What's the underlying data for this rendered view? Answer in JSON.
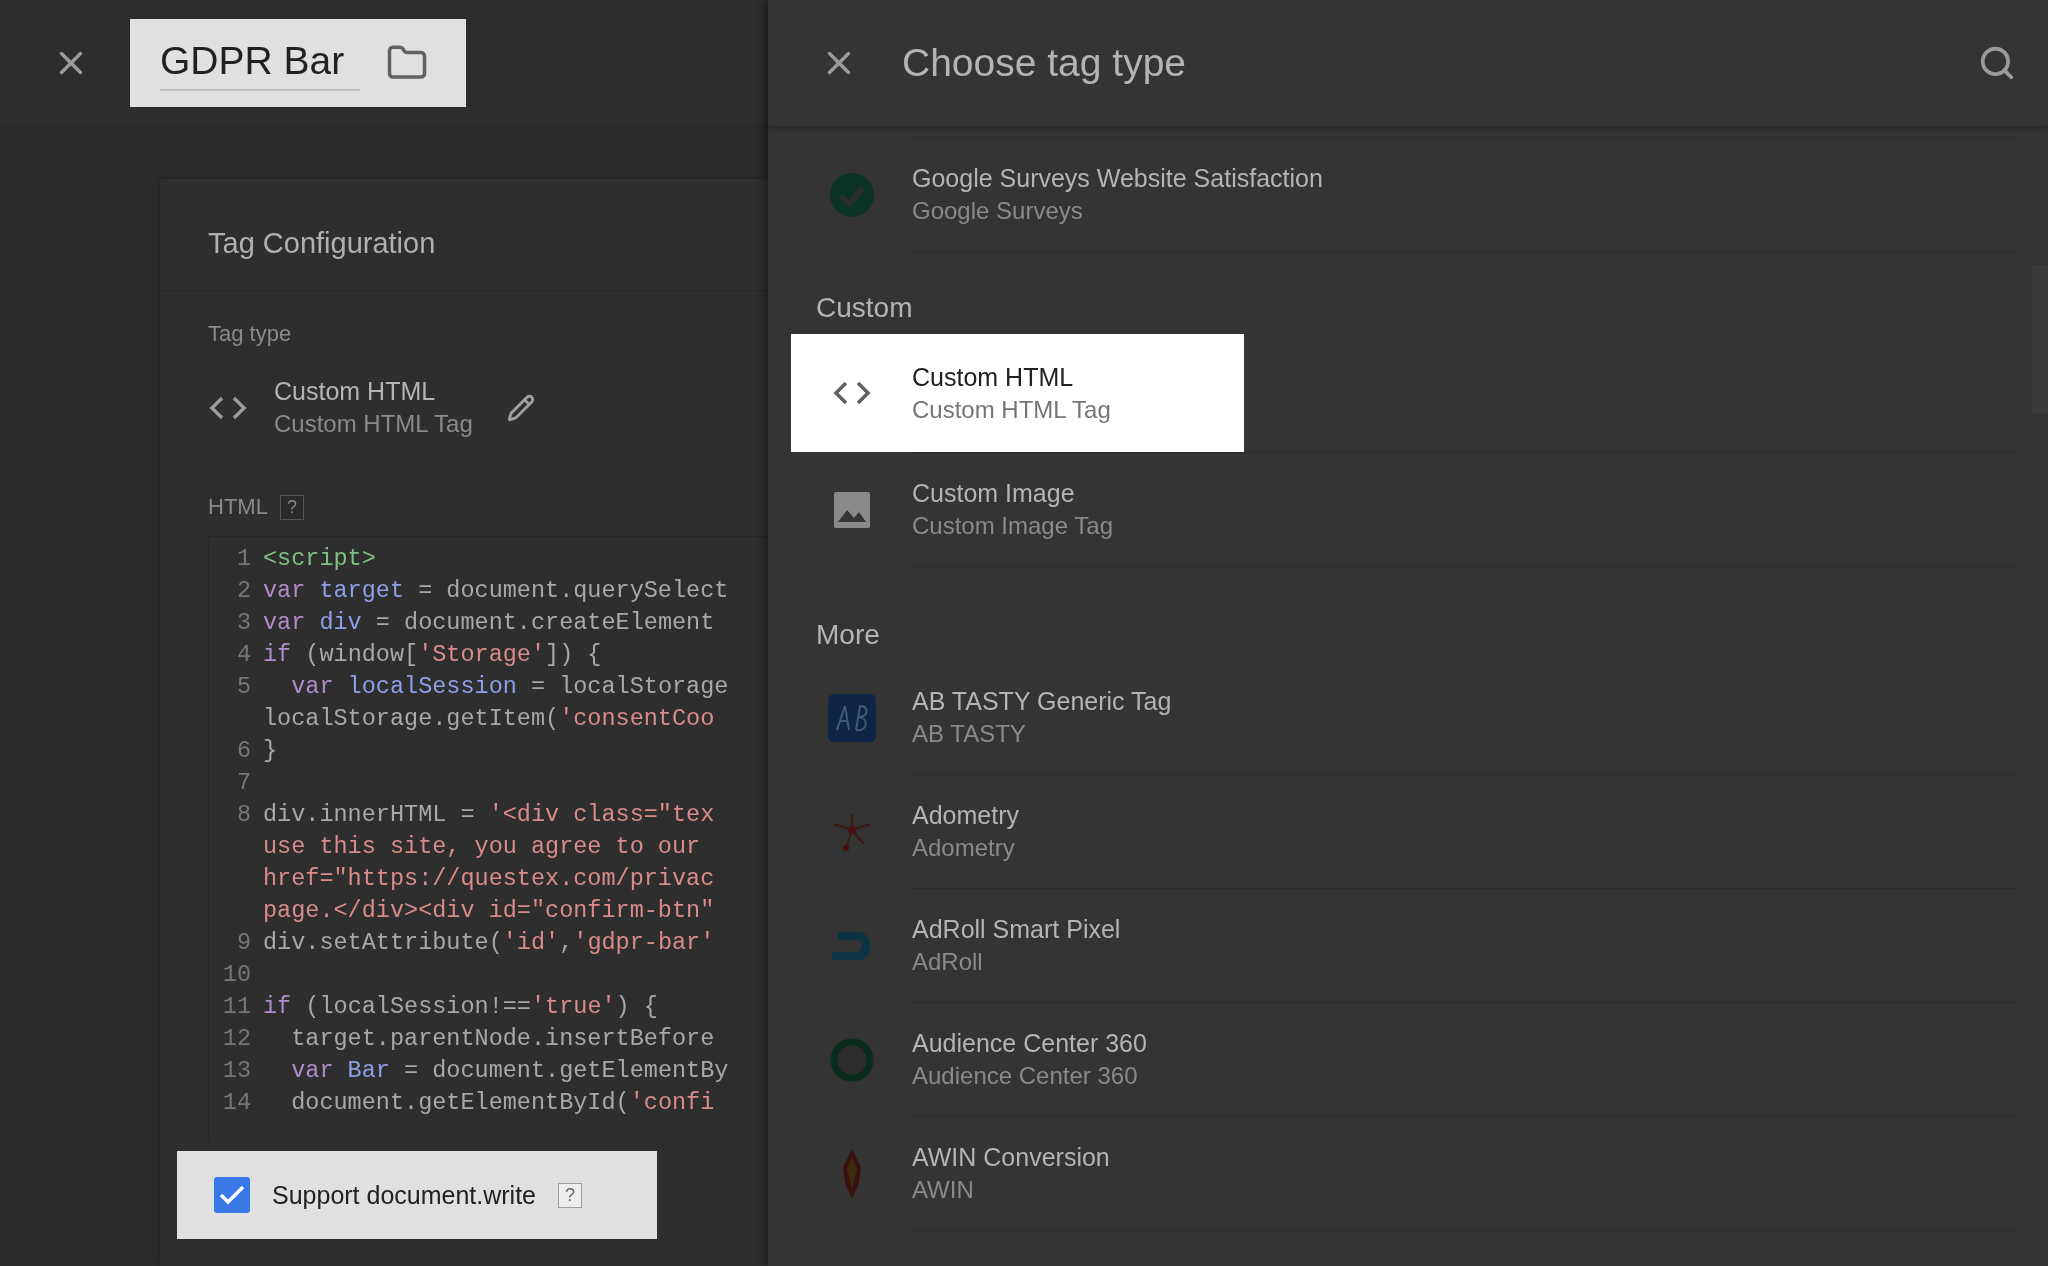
{
  "editor": {
    "title": {
      "text": "GDPR Bar",
      "highlighted": true
    },
    "card": {
      "title": "Tag Configuration",
      "tag_type_label": "Tag type",
      "tag": {
        "name": "Custom HTML",
        "description": "Custom HTML Tag"
      },
      "html_label": "HTML",
      "html_help": "?",
      "code_lines": [
        {
          "number": "1",
          "segments": [
            {
              "kind": "tag",
              "text": "<script>"
            }
          ]
        },
        {
          "number": "2",
          "segments": [
            {
              "kind": "keyword",
              "text": "var"
            },
            {
              "kind": "variable",
              "text": " target"
            },
            {
              "kind": "plain",
              "text": " = document.querySelect"
            }
          ]
        },
        {
          "number": "3",
          "segments": [
            {
              "kind": "keyword",
              "text": "var"
            },
            {
              "kind": "variable",
              "text": " div"
            },
            {
              "kind": "plain",
              "text": " = document.createElement"
            }
          ]
        },
        {
          "number": "4",
          "segments": [
            {
              "kind": "keyword",
              "text": "if"
            },
            {
              "kind": "plain",
              "text": " (window["
            },
            {
              "kind": "string",
              "text": "'Storage'"
            },
            {
              "kind": "plain",
              "text": "]) {"
            }
          ]
        },
        {
          "number": "5",
          "segments": [
            {
              "kind": "keyword",
              "text": "  var"
            },
            {
              "kind": "variable",
              "text": " localSession"
            },
            {
              "kind": "plain",
              "text": " = localStorage"
            }
          ]
        },
        {
          "segments": [
            {
              "kind": "plain",
              "text": "localStorage.getItem("
            },
            {
              "kind": "string",
              "text": "'consentCoo"
            }
          ]
        },
        {
          "number": "6",
          "segments": [
            {
              "kind": "plain",
              "text": "}"
            }
          ]
        },
        {
          "number": "7"
        },
        {
          "number": "8",
          "segments": [
            {
              "kind": "plain",
              "text": "div.innerHTML = "
            },
            {
              "kind": "string",
              "text": "'<div class=\"tex"
            }
          ]
        },
        {
          "segments": [
            {
              "kind": "string",
              "text": "use this site, you agree to our"
            }
          ]
        },
        {
          "segments": [
            {
              "kind": "string",
              "text": "href=\"https://questex.com/privac"
            }
          ]
        },
        {
          "segments": [
            {
              "kind": "string",
              "text": "page.</div><div id=\"confirm-btn\""
            }
          ]
        },
        {
          "number": "9",
          "segments": [
            {
              "kind": "plain",
              "text": "div.setAttribute("
            },
            {
              "kind": "string",
              "text": "'id'"
            },
            {
              "kind": "plain",
              "text": ","
            },
            {
              "kind": "string",
              "text": "'gdpr-bar'"
            }
          ]
        },
        {
          "number": "10"
        },
        {
          "number": "11",
          "segments": [
            {
              "kind": "keyword",
              "text": "if"
            },
            {
              "kind": "plain",
              "text": " (localSession!=="
            },
            {
              "kind": "string",
              "text": "'true'"
            },
            {
              "kind": "plain",
              "text": ") {"
            }
          ]
        },
        {
          "number": "12",
          "segments": [
            {
              "kind": "plain",
              "text": "  target.parentNode.insertBefore"
            }
          ]
        },
        {
          "number": "13",
          "segments": [
            {
              "kind": "keyword",
              "text": "  var"
            },
            {
              "kind": "variable",
              "text": " Bar"
            },
            {
              "kind": "plain",
              "text": " = document.getElementBy"
            }
          ]
        },
        {
          "number": "14",
          "segments": [
            {
              "kind": "plain",
              "text": "  document.getElementById("
            },
            {
              "kind": "string",
              "text": "'confi"
            }
          ]
        }
      ],
      "support_write": {
        "label": "Support document.write",
        "help": "?",
        "checked": true,
        "highlighted": true
      }
    }
  },
  "picker": {
    "title": "Choose tag type",
    "groups": [
      {
        "items": [
          {
            "name": "Google Surveys Website Satisfaction",
            "vendor": "Google Surveys",
            "kind": "check",
            "highlighted": false
          }
        ]
      },
      {
        "heading": "Custom",
        "items": [
          {
            "name": "Custom HTML",
            "vendor": "Custom HTML Tag",
            "kind": "code",
            "highlighted": true
          },
          {
            "name": "Custom Image",
            "vendor": "Custom Image Tag",
            "kind": "image",
            "highlighted": false
          }
        ]
      },
      {
        "heading": "More",
        "items": [
          {
            "name": "AB TASTY Generic Tag",
            "vendor": "AB TASTY",
            "kind": "ab",
            "highlighted": false
          },
          {
            "name": "Adometry",
            "vendor": "Adometry",
            "kind": "star",
            "highlighted": false
          },
          {
            "name": "AdRoll Smart Pixel",
            "vendor": "AdRoll",
            "kind": "hook",
            "highlighted": false
          },
          {
            "name": "Audience Center 360",
            "vendor": "Audience Center 360",
            "kind": "ring",
            "highlighted": false
          },
          {
            "name": "AWIN Conversion",
            "vendor": "AWIN",
            "kind": "flame",
            "highlighted": false
          }
        ]
      }
    ]
  }
}
